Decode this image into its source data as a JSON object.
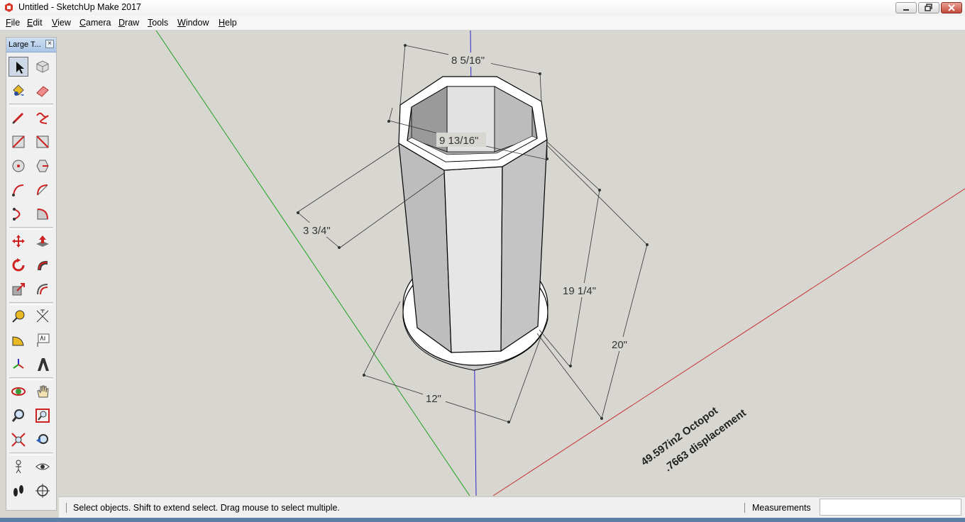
{
  "window": {
    "title": "Untitled - SketchUp Make 2017"
  },
  "menu": [
    "File",
    "Edit",
    "View",
    "Camera",
    "Draw",
    "Tools",
    "Window",
    "Help"
  ],
  "toolbar": {
    "title": "Large T...",
    "close_glyph": "×",
    "tools": [
      "select-icon",
      "make-component-icon",
      "paint-bucket-icon",
      "eraser-icon",
      "line-icon",
      "freehand-icon",
      "rectangle-icon",
      "rotated-rectangle-icon",
      "circle-icon",
      "polygon-icon",
      "arc-icon",
      "two-point-arc-icon",
      "three-point-arc-icon",
      "pie-icon",
      "move-icon",
      "push-pull-icon",
      "rotate-icon",
      "follow-me-icon",
      "scale-icon",
      "offset-icon",
      "tape-measure-icon",
      "dimension-icon",
      "protractor-icon",
      "text-icon",
      "axes-icon",
      "3d-text-icon",
      "orbit-icon",
      "pan-icon",
      "zoom-icon",
      "zoom-window-icon",
      "zoom-extents-icon",
      "previous-view-icon",
      "position-camera-icon",
      "look-around-icon",
      "walk-icon",
      "section-plane-icon"
    ]
  },
  "drawing": {
    "dimensions": [
      "8 5/16\"",
      "9 13/16\"",
      "3 3/4\"",
      "19 1/4\"",
      "20\"",
      "12\""
    ],
    "note_line1": "49.597in2 Octopot",
    "note_line2": ".7663 displacement",
    "axis_colors": {
      "red": "#c83232",
      "green": "#22a022",
      "blue": "#2828c8"
    }
  },
  "status": {
    "message": "Select objects. Shift to extend select. Drag mouse to select multiple.",
    "measurements_label": "Measurements",
    "measurements_value": ""
  }
}
